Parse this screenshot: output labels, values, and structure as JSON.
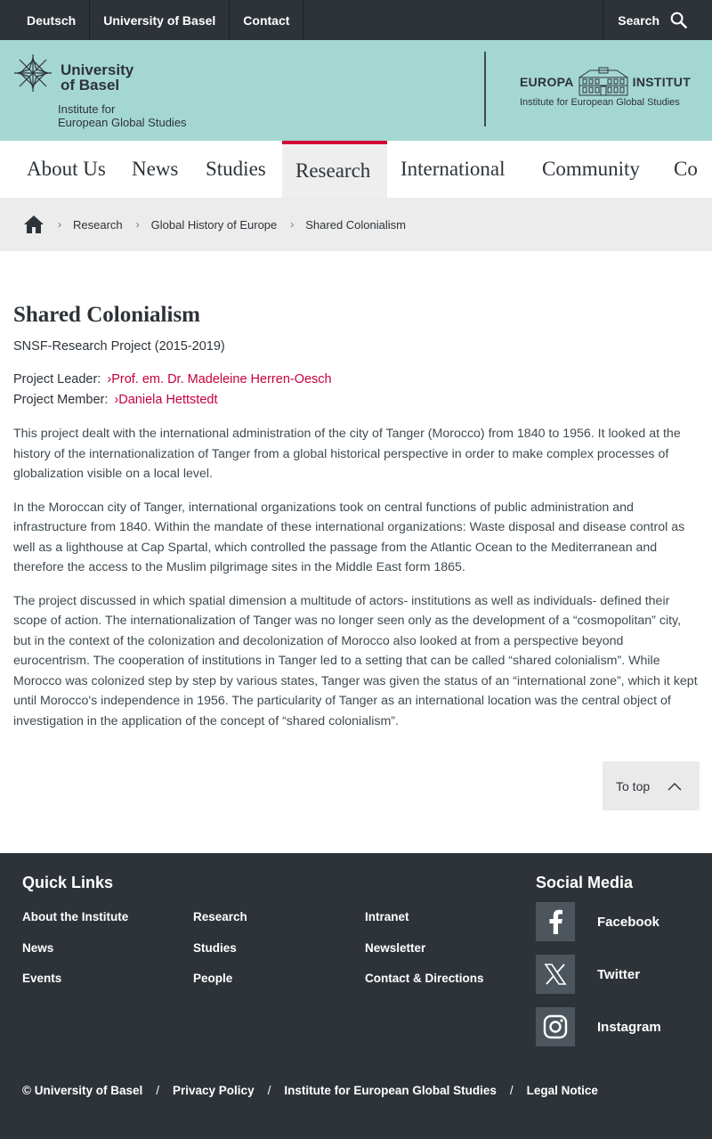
{
  "topbar": {
    "links": [
      "Deutsch",
      "University of Basel",
      "Contact"
    ],
    "search_label": "Search"
  },
  "header": {
    "university_line1": "University",
    "university_line2": "of Basel",
    "institute_line1": "Institute for",
    "institute_line2": "European Global Studies",
    "europa_word1": "EUROPA",
    "europa_word2": "INSTITUT",
    "europa_sub": "Institute for European Global Studies"
  },
  "nav": {
    "items": [
      "About Us",
      "News",
      "Studies",
      "Research",
      "International",
      "Community",
      "Co"
    ],
    "active": "Research"
  },
  "breadcrumb": {
    "items": [
      "Research",
      "Global History of Europe",
      "Shared Colonialism"
    ]
  },
  "page": {
    "title": "Shared Colonialism",
    "subtitle": "SNSF-Research Project (2015-2019)",
    "leader_label": "Project Leader:",
    "leader_name": "Prof. em. Dr. Madeleine Herren-Oesch",
    "member_label": "Project Member:",
    "member_name": "Daniela Hettstedt",
    "paragraphs": [
      "This project dealt with the international administration of the city of Tanger (Morocco) from 1840 to 1956. It looked at the history of the internationalization of Tanger from a global historical perspective in order to make complex processes of globalization visible on a local level.",
      "In the Moroccan city of Tanger, international organizations took on central functions of public administration and infrastructure from 1840. Within the mandate of these international organizations: Waste disposal and disease control as well as a lighthouse at Cap Spartal, which controlled the passage from the Atlantic Ocean to the Mediterranean and therefore the access to the Muslim pilgrimage sites in the Middle East form 1865.",
      "The project discussed in which spatial dimension a multitude of actors- institutions as well as individuals- defined their scope of action. The internationalization of Tanger was no longer seen only as the development of a “cosmopolitan” city, but in the context of the colonization and decolonization of Morocco also looked at from a perspective beyond eurocentrism. The cooperation of institutions in Tanger led to a setting that can be called “shared colonialism”. While Morocco was colonized step by step by various states, Tanger was given the status of an “international zone”, which it kept until Morocco's independence in 1956. The particularity of Tanger as an international location was the central object of investigation in the application of the concept of “shared colonialism”."
    ],
    "to_top": "To top"
  },
  "footer": {
    "quick_links_title": "Quick Links",
    "col1": [
      "About the Institute",
      "News",
      "Events"
    ],
    "col2": [
      "Research",
      "Studies",
      "People"
    ],
    "col3": [
      "Intranet",
      "Newsletter",
      "Contact & Directions"
    ],
    "social_title": "Social Media",
    "social": [
      {
        "label": "Facebook",
        "icon": "facebook-icon"
      },
      {
        "label": "Twitter",
        "icon": "x-twitter-icon"
      },
      {
        "label": "Instagram",
        "icon": "instagram-icon"
      }
    ],
    "legal": [
      "© University of Basel",
      "Privacy Policy",
      "Institute for European Global Studies",
      "Legal Notice"
    ]
  },
  "colors": {
    "topbar": "#2d3339",
    "header": "#a5d7d2",
    "accent": "#d20537",
    "link": "#c5003c",
    "footer": "#2d3339"
  }
}
